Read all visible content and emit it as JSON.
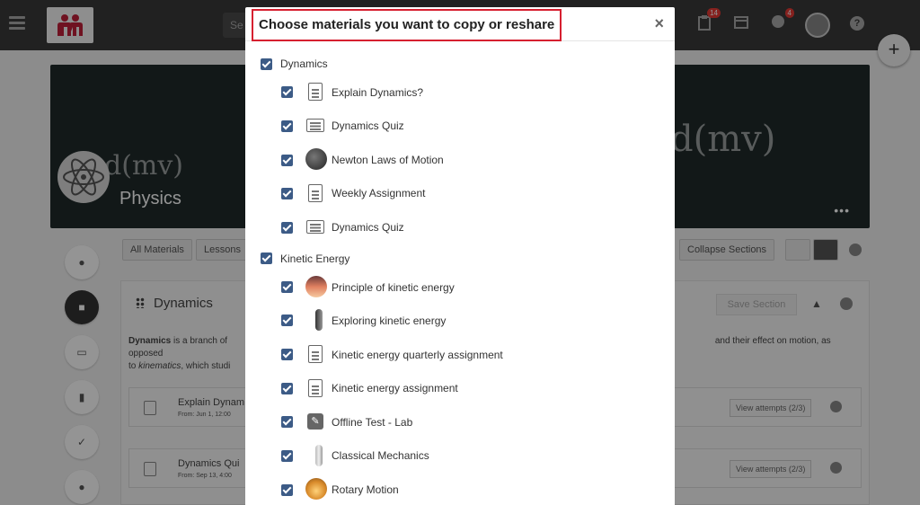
{
  "topbar": {
    "search_placeholder": "Se",
    "task_badge": "14",
    "notif_badge": "4"
  },
  "banner": {
    "title": "Physics",
    "chalk_left": "d(mv)",
    "chalk_right": "d(mv)",
    "more": "•••"
  },
  "filters": {
    "all_materials": "All Materials",
    "lessons": "Lessons",
    "collapse_sections": "Collapse Sections"
  },
  "section": {
    "title": "Dynamics",
    "save_label": "Save Section",
    "description_bold": "Dynamics",
    "description_start": " is a branch of ",
    "description_end": " and their effect on motion, as opposed",
    "description_line2_italic": "kinematics",
    "description_line2_prefix": "to ",
    "description_line2_suffix": ", which studi",
    "rows": [
      {
        "title": "Explain Dynam",
        "subtitle": "From: Jun 1, 12:00",
        "attempts": "View attempts (2/3)"
      },
      {
        "title": "Dynamics Qui",
        "subtitle": "From: Sep 13, 4:00",
        "attempts": "View attempts (2/3)"
      }
    ]
  },
  "modal": {
    "title": "Choose materials you want to copy or reshare",
    "close": "×",
    "groups": [
      {
        "label": "Dynamics",
        "checked": true,
        "items": [
          {
            "label": "Explain Dynamics?",
            "icon": "document-icon",
            "checked": true
          },
          {
            "label": "Dynamics Quiz",
            "icon": "quiz-icon",
            "checked": true
          },
          {
            "label": "Newton Laws of Motion",
            "icon": "image-thumbnail-icon",
            "checked": true
          },
          {
            "label": "Weekly Assignment",
            "icon": "document-icon",
            "checked": true
          },
          {
            "label": "Dynamics Quiz",
            "icon": "quiz-icon",
            "checked": true
          }
        ]
      },
      {
        "label": "Kinetic Energy",
        "checked": true,
        "items": [
          {
            "label": "Principle of kinetic energy",
            "icon": "image-thumbnail-icon",
            "checked": true
          },
          {
            "label": "Exploring kinetic energy",
            "icon": "image-thumbnail-icon",
            "checked": true
          },
          {
            "label": "Kinetic energy quarterly assignment",
            "icon": "document-icon",
            "checked": true
          },
          {
            "label": "Kinetic energy assignment",
            "icon": "document-icon",
            "checked": true
          },
          {
            "label": "Offline Test - Lab",
            "icon": "pencil-icon",
            "checked": true
          },
          {
            "label": "Classical Mechanics",
            "icon": "image-thumbnail-icon",
            "checked": true
          },
          {
            "label": "Rotary Motion",
            "icon": "image-thumbnail-icon",
            "checked": true
          }
        ]
      }
    ]
  },
  "colors": {
    "checkbox": "#3c5b86",
    "title_highlight": "#d62030",
    "topbar": "#3a3a3a",
    "logo_accent": "#c0203a"
  }
}
